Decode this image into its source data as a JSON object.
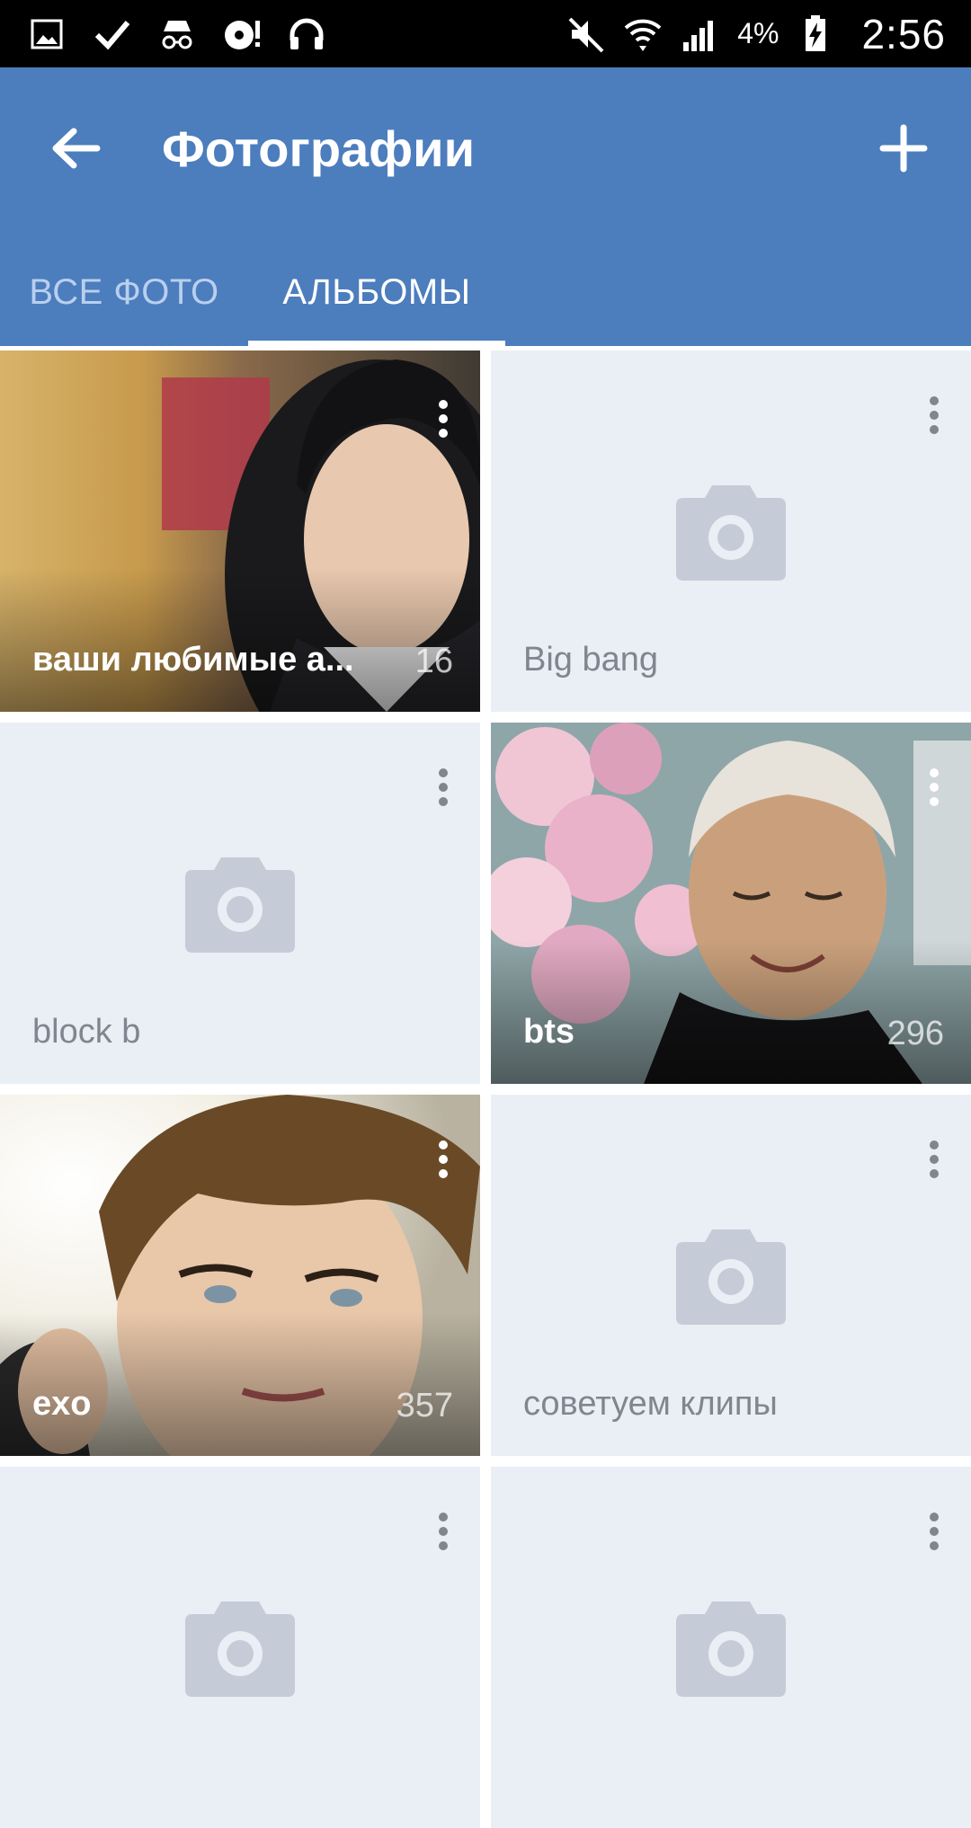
{
  "status_bar": {
    "battery_percent": "4%",
    "time": "2:56",
    "icons": [
      "gallery-icon",
      "check-icon",
      "incognito-icon",
      "disk-alert-icon",
      "headphones-icon",
      "mute-icon",
      "wifi-icon",
      "signal-icon",
      "battery-charging-icon"
    ]
  },
  "header": {
    "title": "Фотографии",
    "back_icon": "arrow-left-icon",
    "add_icon": "plus-icon"
  },
  "tabs": [
    {
      "label": "ВСЕ ФОТО",
      "active": false
    },
    {
      "label": "АЛЬБОМЫ",
      "active": true
    }
  ],
  "albums": [
    {
      "name": "ваши любимые а...",
      "count": "16",
      "has_cover": true
    },
    {
      "name": "Big bang",
      "count": "",
      "has_cover": false
    },
    {
      "name": "block b",
      "count": "",
      "has_cover": false
    },
    {
      "name": "bts",
      "count": "296",
      "has_cover": true
    },
    {
      "name": "exo",
      "count": "357",
      "has_cover": true
    },
    {
      "name": "советуем клипы",
      "count": "",
      "has_cover": false
    },
    {
      "name": "",
      "count": "",
      "has_cover": false
    },
    {
      "name": "",
      "count": "",
      "has_cover": false
    }
  ],
  "colors": {
    "accent": "#4c7dbd",
    "placeholder_bg": "#eaeef5",
    "camera_icon": "#c5ccd8"
  }
}
